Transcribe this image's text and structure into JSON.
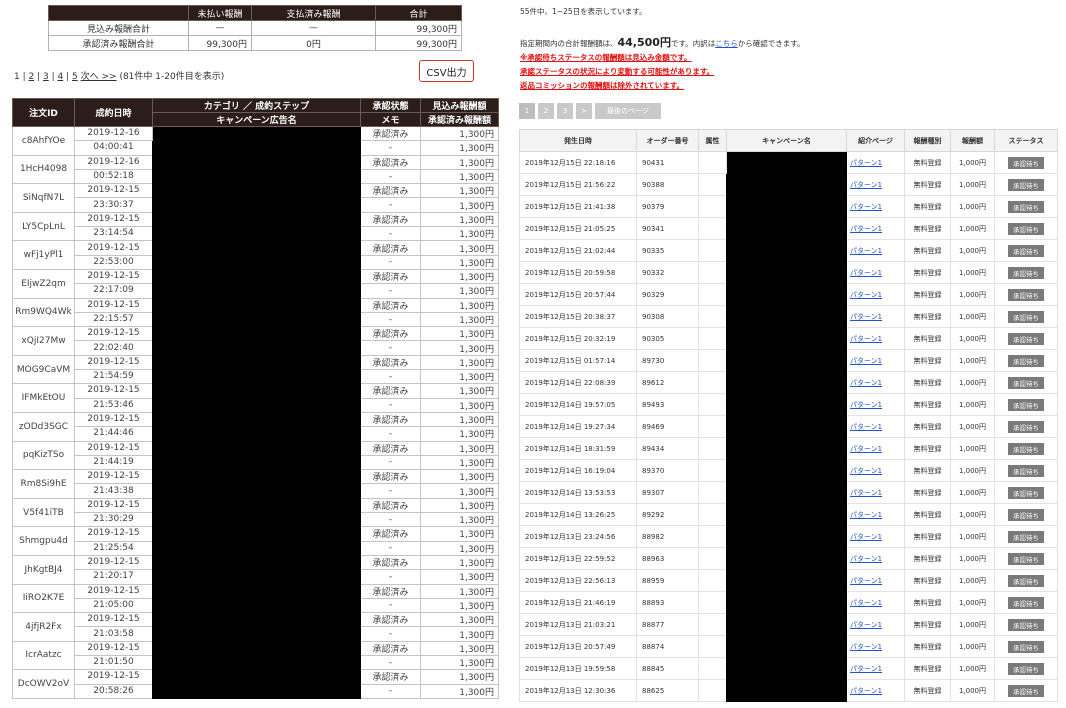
{
  "left": {
    "summary": {
      "headers": [
        "",
        "未払い報酬",
        "支払済み報酬",
        "合計"
      ],
      "rows": [
        [
          "見込み報酬合計",
          "—",
          "—",
          "99,300円"
        ],
        [
          "承認済み報酬合計",
          "99,300円",
          "0円",
          "99,300円"
        ]
      ]
    },
    "pager": {
      "pages": [
        "1",
        "2",
        "3",
        "4",
        "5"
      ],
      "next_label": "次へ >>",
      "info": "(81件中 1-20件目を表示)"
    },
    "csv_button": "CSV出力",
    "table": {
      "h_order_id": "注文ID",
      "h_date": "成約日時",
      "h_category": "カテゴリ ／ 成約ステップ",
      "h_campaign": "キャンペーン広告名",
      "h_status": "承認状態",
      "h_memo": "メモ",
      "h_expected": "見込み報酬額",
      "h_approved": "承認済み報酬額",
      "rows": [
        {
          "id": "c8AhfYOe",
          "date": "2019-12-16",
          "time": "04:00:41",
          "status": "承認済み",
          "memo": "-",
          "a1": "1,300円",
          "a2": "1,300円"
        },
        {
          "id": "1HcH4098",
          "date": "2019-12-16",
          "time": "00:52:18",
          "status": "承認済み",
          "memo": "-",
          "a1": "1,300円",
          "a2": "1,300円"
        },
        {
          "id": "SiNqfN7L",
          "date": "2019-12-15",
          "time": "23:30:37",
          "status": "承認済み",
          "memo": "-",
          "a1": "1,300円",
          "a2": "1,300円"
        },
        {
          "id": "LY5CpLnL",
          "date": "2019-12-15",
          "time": "23:14:54",
          "status": "承認済み",
          "memo": "-",
          "a1": "1,300円",
          "a2": "1,300円"
        },
        {
          "id": "wFj1yPl1",
          "date": "2019-12-15",
          "time": "22:53:00",
          "status": "承認済み",
          "memo": "-",
          "a1": "1,300円",
          "a2": "1,300円"
        },
        {
          "id": "EIjwZ2qm",
          "date": "2019-12-15",
          "time": "22:17:09",
          "status": "承認済み",
          "memo": "-",
          "a1": "1,300円",
          "a2": "1,300円"
        },
        {
          "id": "Rm9WQ4Wk",
          "date": "2019-12-15",
          "time": "22:15:57",
          "status": "承認済み",
          "memo": "-",
          "a1": "1,300円",
          "a2": "1,300円"
        },
        {
          "id": "xQjI27Mw",
          "date": "2019-12-15",
          "time": "22:02:40",
          "status": "承認済み",
          "memo": "-",
          "a1": "1,300円",
          "a2": "1,300円"
        },
        {
          "id": "MOG9CaVM",
          "date": "2019-12-15",
          "time": "21:54:59",
          "status": "承認済み",
          "memo": "-",
          "a1": "1,300円",
          "a2": "1,300円"
        },
        {
          "id": "IFMkEtOU",
          "date": "2019-12-15",
          "time": "21:53:46",
          "status": "承認済み",
          "memo": "-",
          "a1": "1,300円",
          "a2": "1,300円"
        },
        {
          "id": "zODd3SGC",
          "date": "2019-12-15",
          "time": "21:44:46",
          "status": "承認済み",
          "memo": "-",
          "a1": "1,300円",
          "a2": "1,300円"
        },
        {
          "id": "pqKizTSo",
          "date": "2019-12-15",
          "time": "21:44:19",
          "status": "承認済み",
          "memo": "-",
          "a1": "1,300円",
          "a2": "1,300円"
        },
        {
          "id": "Rm8Si9hE",
          "date": "2019-12-15",
          "time": "21:43:38",
          "status": "承認済み",
          "memo": "-",
          "a1": "1,300円",
          "a2": "1,300円"
        },
        {
          "id": "V5f41iTB",
          "date": "2019-12-15",
          "time": "21:30:29",
          "status": "承認済み",
          "memo": "-",
          "a1": "1,300円",
          "a2": "1,300円"
        },
        {
          "id": "Shmgpu4d",
          "date": "2019-12-15",
          "time": "21:25:54",
          "status": "承認済み",
          "memo": "-",
          "a1": "1,300円",
          "a2": "1,300円"
        },
        {
          "id": "JhKgtBJ4",
          "date": "2019-12-15",
          "time": "21:20:17",
          "status": "承認済み",
          "memo": "-",
          "a1": "1,300円",
          "a2": "1,300円"
        },
        {
          "id": "IiRO2K7E",
          "date": "2019-12-15",
          "time": "21:05:00",
          "status": "承認済み",
          "memo": "-",
          "a1": "1,300円",
          "a2": "1,300円"
        },
        {
          "id": "4jfjR2Fx",
          "date": "2019-12-15",
          "time": "21:03:58",
          "status": "承認済み",
          "memo": "-",
          "a1": "1,300円",
          "a2": "1,300円"
        },
        {
          "id": "IcrAatzc",
          "date": "2019-12-15",
          "time": "21:01:50",
          "status": "承認済み",
          "memo": "-",
          "a1": "1,300円",
          "a2": "1,300円"
        },
        {
          "id": "DcOWV2oV",
          "date": "2019-12-15",
          "time": "20:58:26",
          "status": "承認済み",
          "memo": "-",
          "a1": "1,300円",
          "a2": "1,300円"
        }
      ]
    }
  },
  "right": {
    "count_text": "55件中、1~25日を表示しています。",
    "total_prefix": "指定期間内の合計報酬額は、",
    "total_amount": "44,500円",
    "total_mid": "です。内訳は",
    "total_link": "こちら",
    "total_suffix": "から確認できます。",
    "warnings": [
      "※承認待ちステータスの報酬額は見込み金額です。",
      "承認ステータスの状況により変動する可能性があります。",
      "返品コミッションの報酬額は除外されています。"
    ],
    "pager": [
      "1",
      "2",
      "3",
      ">",
      "最後のページ"
    ],
    "table": {
      "headers": [
        "発生日時",
        "オーダー番号",
        "属性",
        "キャンペーン名",
        "紹介ページ",
        "報酬種別",
        "報酬額",
        "ステータス"
      ],
      "rows": [
        {
          "dt": "2019年12月15日 22:18:16",
          "no": "90431",
          "page": "パターン1",
          "type": "無料登録",
          "amt": "1,000円",
          "st": "承認待ち"
        },
        {
          "dt": "2019年12月15日 21:56:22",
          "no": "90388",
          "page": "パターン1",
          "type": "無料登録",
          "amt": "1,000円",
          "st": "承認待ち"
        },
        {
          "dt": "2019年12月15日 21:41:38",
          "no": "90379",
          "page": "パターン1",
          "type": "無料登録",
          "amt": "1,000円",
          "st": "承認待ち"
        },
        {
          "dt": "2019年12月15日 21:05:25",
          "no": "90341",
          "page": "パターン1",
          "type": "無料登録",
          "amt": "1,000円",
          "st": "承認待ち"
        },
        {
          "dt": "2019年12月15日 21:02:44",
          "no": "90335",
          "page": "パターン1",
          "type": "無料登録",
          "amt": "1,000円",
          "st": "承認待ち"
        },
        {
          "dt": "2019年12月15日 20:59:58",
          "no": "90332",
          "page": "パターン1",
          "type": "無料登録",
          "amt": "1,000円",
          "st": "承認待ち"
        },
        {
          "dt": "2019年12月15日 20:57:44",
          "no": "90329",
          "page": "パターン1",
          "type": "無料登録",
          "amt": "1,000円",
          "st": "承認待ち"
        },
        {
          "dt": "2019年12月15日 20:38:37",
          "no": "90308",
          "page": "パターン1",
          "type": "無料登録",
          "amt": "1,000円",
          "st": "承認待ち"
        },
        {
          "dt": "2019年12月15日 20:32:19",
          "no": "90305",
          "page": "パターン1",
          "type": "無料登録",
          "amt": "1,000円",
          "st": "承認待ち"
        },
        {
          "dt": "2019年12月15日 01:57:14",
          "no": "89730",
          "page": "パターン1",
          "type": "無料登録",
          "amt": "1,000円",
          "st": "承認待ち"
        },
        {
          "dt": "2019年12月14日 22:08:39",
          "no": "89612",
          "page": "パターン1",
          "type": "無料登録",
          "amt": "1,000円",
          "st": "承認待ち"
        },
        {
          "dt": "2019年12月14日 19:57:05",
          "no": "89493",
          "page": "パターン1",
          "type": "無料登録",
          "amt": "1,000円",
          "st": "承認待ち"
        },
        {
          "dt": "2019年12月14日 19:27:34",
          "no": "89469",
          "page": "パターン1",
          "type": "無料登録",
          "amt": "1,000円",
          "st": "承認待ち"
        },
        {
          "dt": "2019年12月14日 18:31:59",
          "no": "89434",
          "page": "パターン1",
          "type": "無料登録",
          "amt": "1,000円",
          "st": "承認待ち"
        },
        {
          "dt": "2019年12月14日 16:19:04",
          "no": "89370",
          "page": "パターン1",
          "type": "無料登録",
          "amt": "1,000円",
          "st": "承認待ち"
        },
        {
          "dt": "2019年12月14日 13:53:53",
          "no": "89307",
          "page": "パターン1",
          "type": "無料登録",
          "amt": "1,000円",
          "st": "承認待ち"
        },
        {
          "dt": "2019年12月14日 13:26:25",
          "no": "89292",
          "page": "パターン1",
          "type": "無料登録",
          "amt": "1,000円",
          "st": "承認待ち"
        },
        {
          "dt": "2019年12月13日 23:24:56",
          "no": "88982",
          "page": "パターン1",
          "type": "無料登録",
          "amt": "1,000円",
          "st": "承認待ち"
        },
        {
          "dt": "2019年12月13日 22:59:52",
          "no": "88963",
          "page": "パターン1",
          "type": "無料登録",
          "amt": "1,000円",
          "st": "承認待ち"
        },
        {
          "dt": "2019年12月13日 22:56:13",
          "no": "88959",
          "page": "パターン1",
          "type": "無料登録",
          "amt": "1,000円",
          "st": "承認待ち"
        },
        {
          "dt": "2019年12月13日 21:46:19",
          "no": "88893",
          "page": "パターン1",
          "type": "無料登録",
          "amt": "1,000円",
          "st": "承認待ち"
        },
        {
          "dt": "2019年12月13日 21:03:21",
          "no": "88877",
          "page": "パターン1",
          "type": "無料登録",
          "amt": "1,000円",
          "st": "承認待ち"
        },
        {
          "dt": "2019年12月13日 20:57:49",
          "no": "88874",
          "page": "パターン1",
          "type": "無料登録",
          "amt": "1,000円",
          "st": "承認待ち"
        },
        {
          "dt": "2019年12月13日 19:59:58",
          "no": "88845",
          "page": "パターン1",
          "type": "無料登録",
          "amt": "1,000円",
          "st": "承認待ち"
        },
        {
          "dt": "2019年12月13日 12:30:36",
          "no": "88625",
          "page": "パターン1",
          "type": "無料登録",
          "amt": "1,000円",
          "st": "承認待ち"
        }
      ]
    }
  }
}
